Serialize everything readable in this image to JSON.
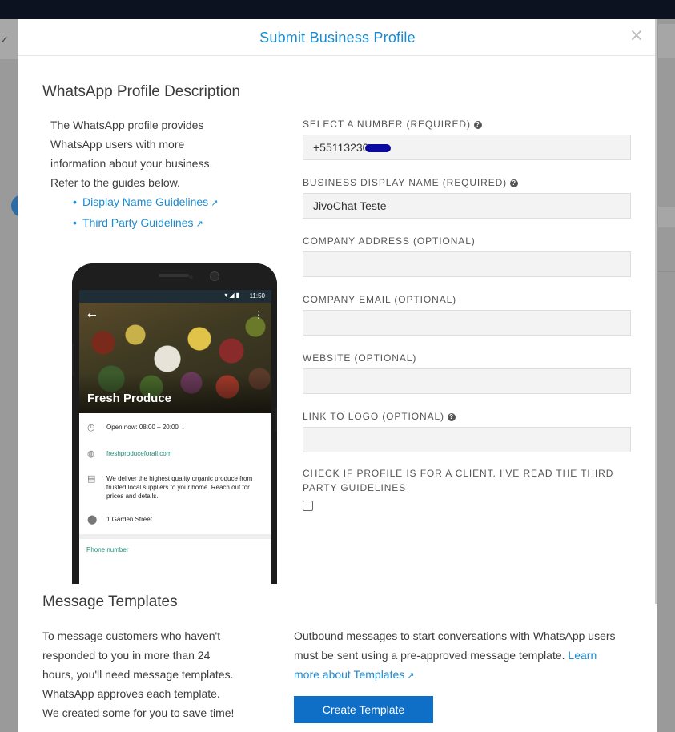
{
  "modal": {
    "title": "Submit Business Profile",
    "close_icon": "close-icon"
  },
  "profile": {
    "section_title": "WhatsApp Profile Description",
    "description": "The WhatsApp profile provides WhatsApp users with more information about your business. Refer to the guides below.",
    "guides": [
      {
        "label": "Display Name Guidelines",
        "icon": "external-link-icon"
      },
      {
        "label": "Third Party Guidelines",
        "icon": "external-link-icon"
      }
    ]
  },
  "phone_preview": {
    "status_time": "11:50",
    "business_name": "Fresh Produce",
    "hours": "Open now: 08:00 – 20:00",
    "website": "freshproduceforall.com",
    "description": "We deliver the highest quality organic produce from trusted local suppliers to your home. Reach out for prices and details.",
    "address": "1 Garden Street",
    "phone_label": "Phone number"
  },
  "form": {
    "number": {
      "label": "SELECT A NUMBER (REQUIRED)",
      "value": "+55113230",
      "redacted": true
    },
    "display_name": {
      "label": "BUSINESS DISPLAY NAME (REQUIRED)",
      "value": "JivoChat Teste"
    },
    "address": {
      "label": "COMPANY ADDRESS (OPTIONAL)",
      "value": ""
    },
    "email": {
      "label": "COMPANY EMAIL (OPTIONAL)",
      "value": ""
    },
    "website": {
      "label": "WEBSITE (OPTIONAL)",
      "value": ""
    },
    "logo": {
      "label": "LINK TO LOGO (OPTIONAL)",
      "value": ""
    },
    "client_check": {
      "label": "CHECK IF PROFILE IS FOR A CLIENT. I'VE READ THE THIRD PARTY GUIDELINES",
      "checked": false
    }
  },
  "templates": {
    "section_title": "Message Templates",
    "left_text": "To message customers who haven't responded to you in more than 24 hours, you'll need message templates. WhatsApp approves each template. We created some for you to save time!",
    "right_text": "Outbound messages to start conversations with WhatsApp users must be sent using a pre-approved message template.",
    "learn_more_link": "Learn more about Templates",
    "create_button": "Create Template"
  },
  "colors": {
    "accent": "#1b8bd0",
    "button": "#0f6fc6",
    "overlay": "#9a9a9a"
  }
}
